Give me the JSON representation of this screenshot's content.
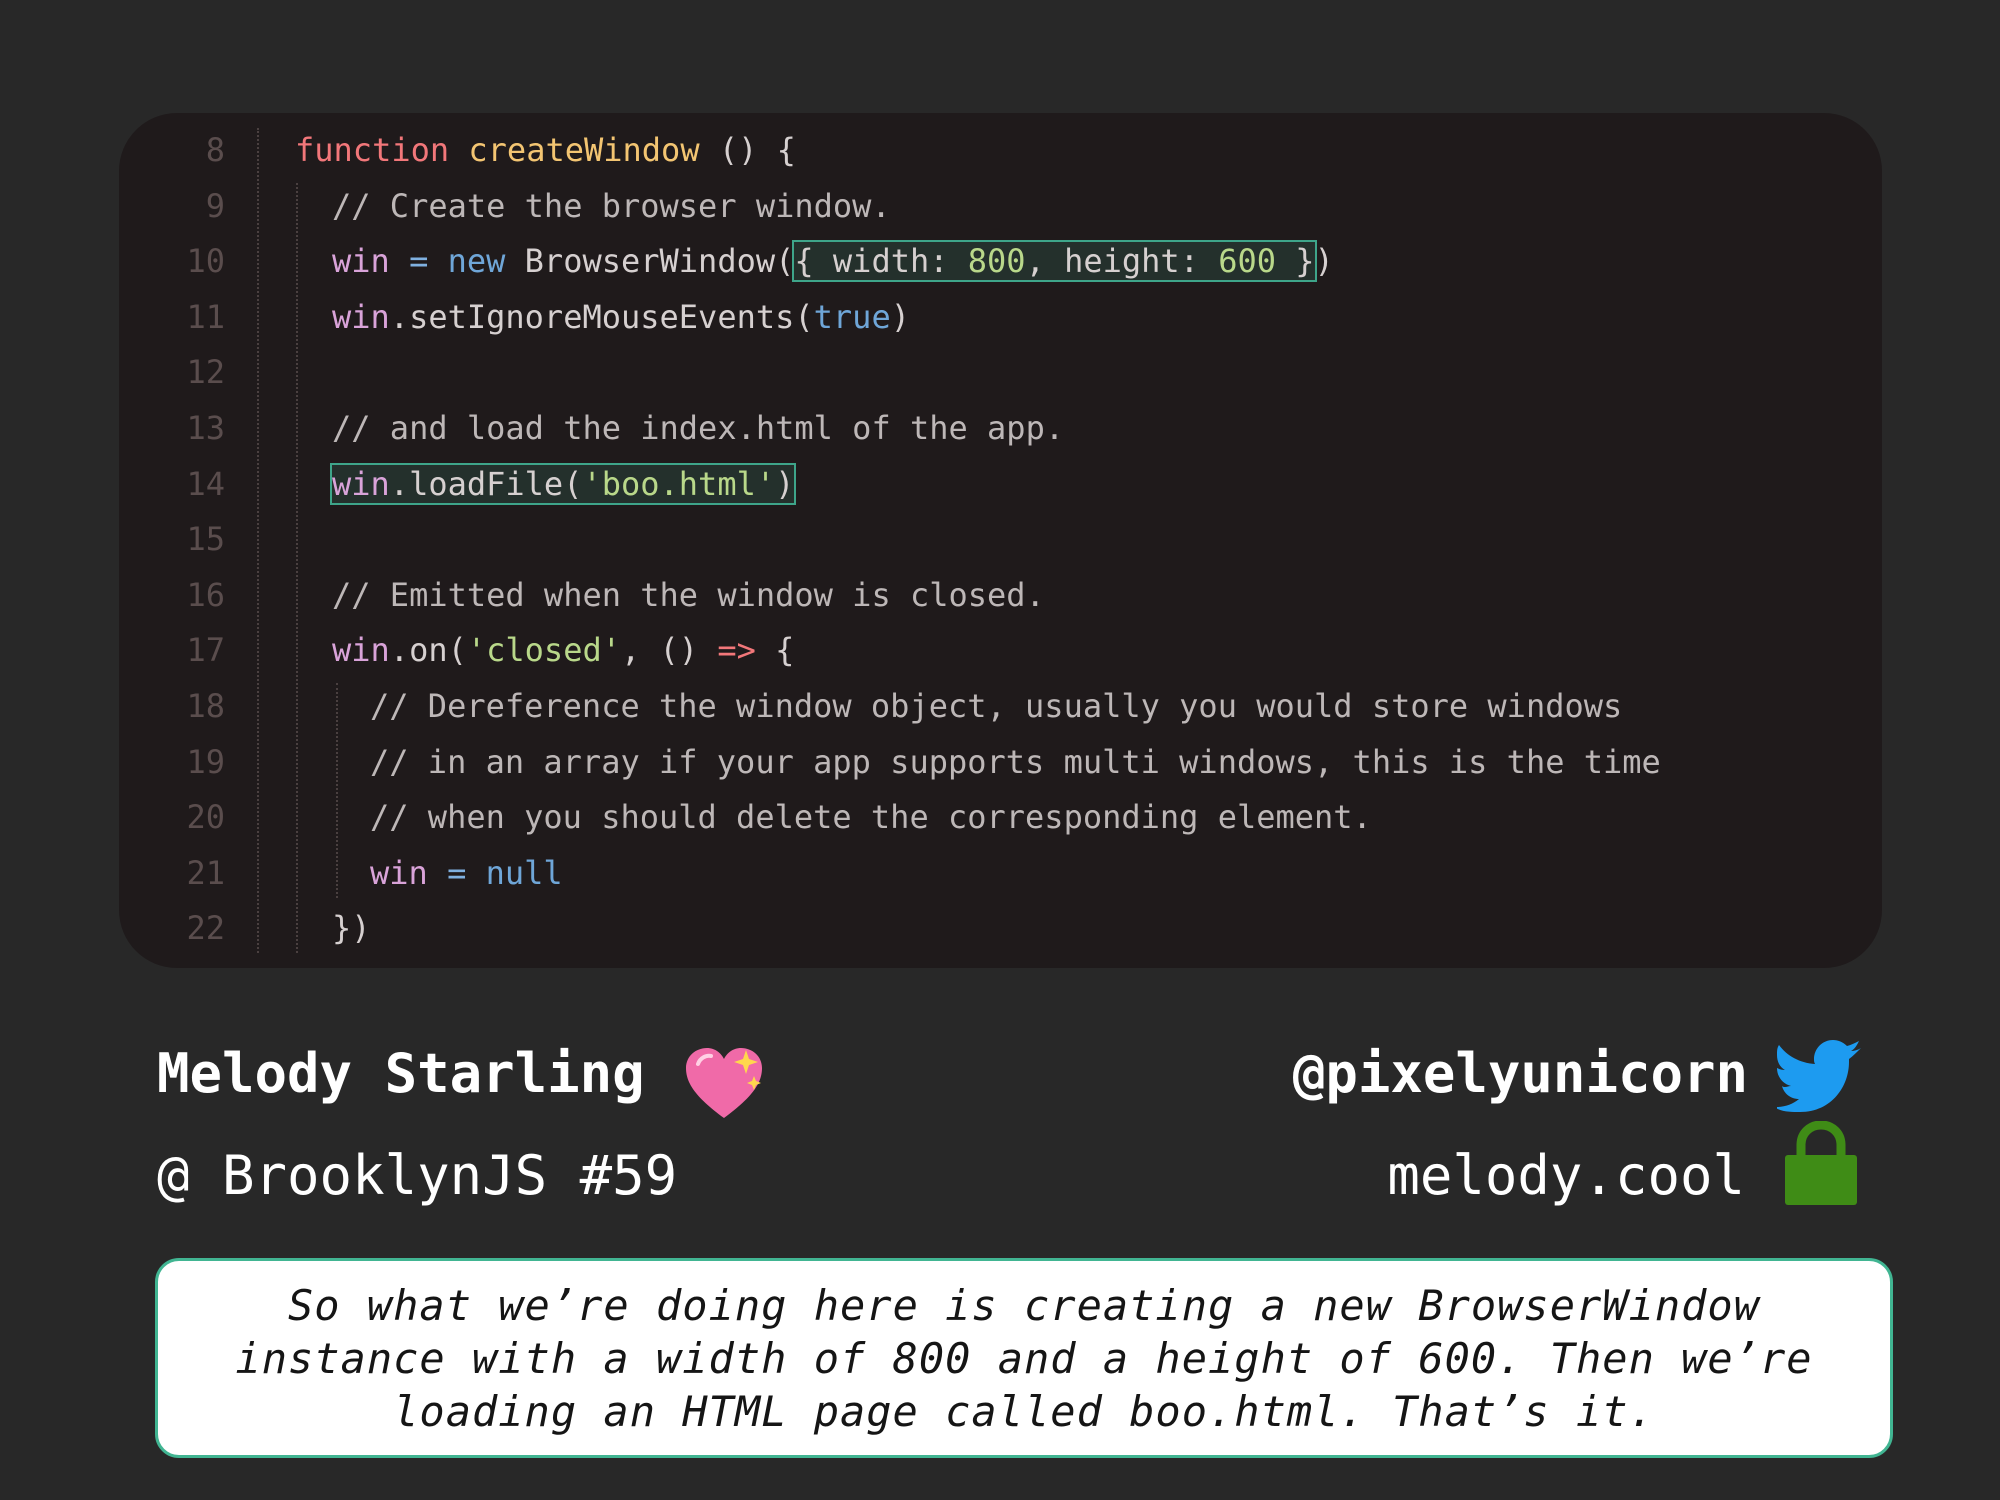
{
  "code": {
    "lines": [
      {
        "n": "8",
        "indent": 0,
        "tokens": [
          {
            "t": "function ",
            "c": "kw"
          },
          {
            "t": "createWindow",
            "c": "fn"
          },
          {
            "t": " () {",
            "c": "plain"
          }
        ]
      },
      {
        "n": "9",
        "indent": 1,
        "tokens": [
          {
            "t": "// Create the browser window.",
            "c": "cm"
          }
        ]
      },
      {
        "n": "10",
        "indent": 1,
        "tokens": [
          {
            "t": "win",
            "c": "var"
          },
          {
            "t": " = ",
            "c": "op"
          },
          {
            "t": "new",
            "c": "lit"
          },
          {
            "t": " BrowserWindow(",
            "c": "plain"
          },
          {
            "t": "{ width: ",
            "c": "plain",
            "hl": true
          },
          {
            "t": "800",
            "c": "num",
            "hl": true
          },
          {
            "t": ", height: ",
            "c": "plain",
            "hl": true
          },
          {
            "t": "600",
            "c": "num",
            "hl": true
          },
          {
            "t": " }",
            "c": "plain",
            "hl": true
          },
          {
            "t": ")",
            "c": "plain"
          }
        ]
      },
      {
        "n": "11",
        "indent": 1,
        "tokens": [
          {
            "t": "win",
            "c": "var"
          },
          {
            "t": ".setIgnoreMouseEvents(",
            "c": "plain"
          },
          {
            "t": "true",
            "c": "lit"
          },
          {
            "t": ")",
            "c": "plain"
          }
        ]
      },
      {
        "n": "12",
        "indent": 1,
        "tokens": []
      },
      {
        "n": "13",
        "indent": 1,
        "tokens": [
          {
            "t": "// and load the index.html of the app.",
            "c": "cm"
          }
        ]
      },
      {
        "n": "14",
        "indent": 1,
        "tokens": [
          {
            "t": "win",
            "c": "var",
            "hl": true
          },
          {
            "t": ".loadFile(",
            "c": "plain",
            "hl": true
          },
          {
            "t": "'boo.html'",
            "c": "str",
            "hl": true
          },
          {
            "t": ")",
            "c": "plain",
            "hl": true
          }
        ]
      },
      {
        "n": "15",
        "indent": 1,
        "tokens": []
      },
      {
        "n": "16",
        "indent": 1,
        "tokens": [
          {
            "t": "// Emitted when the window is closed.",
            "c": "cm"
          }
        ]
      },
      {
        "n": "17",
        "indent": 1,
        "tokens": [
          {
            "t": "win",
            "c": "var"
          },
          {
            "t": ".on(",
            "c": "plain"
          },
          {
            "t": "'closed'",
            "c": "str"
          },
          {
            "t": ", () ",
            "c": "plain"
          },
          {
            "t": "=>",
            "c": "arrow"
          },
          {
            "t": " {",
            "c": "plain"
          }
        ]
      },
      {
        "n": "18",
        "indent": 2,
        "tokens": [
          {
            "t": "// Dereference the window object, usually you would store windows",
            "c": "cm"
          }
        ]
      },
      {
        "n": "19",
        "indent": 2,
        "tokens": [
          {
            "t": "// in an array if your app supports multi windows, this is the time",
            "c": "cm"
          }
        ]
      },
      {
        "n": "20",
        "indent": 2,
        "tokens": [
          {
            "t": "// when you should delete the corresponding element.",
            "c": "cm"
          }
        ]
      },
      {
        "n": "21",
        "indent": 2,
        "tokens": [
          {
            "t": "win",
            "c": "var"
          },
          {
            "t": " = ",
            "c": "op"
          },
          {
            "t": "null",
            "c": "lit"
          }
        ]
      },
      {
        "n": "22",
        "indent": 1,
        "tokens": [
          {
            "t": "})",
            "c": "plain"
          }
        ]
      }
    ]
  },
  "speaker": {
    "name": "Melody Starling",
    "event": "@ BrooklynJS #59",
    "handle": "@pixelyunicorn",
    "website": "melody.cool"
  },
  "icons": {
    "heart": "sparkling-heart-icon",
    "twitter": "twitter-bird-icon",
    "lock": "lock-icon"
  },
  "colors": {
    "background": "#282828",
    "code_panel": "#1f1a1b",
    "highlight": "#3ea58a",
    "twitter_blue": "#1d9bf0",
    "lock_green": "#3f8c16",
    "heart_pink": "#f06aa8"
  },
  "caption": {
    "text": "So what we’re doing here is creating a new BrowserWindow instance with a width of 800 and a height of 600. Then we’re loading an HTML page called boo.html. That’s it."
  }
}
